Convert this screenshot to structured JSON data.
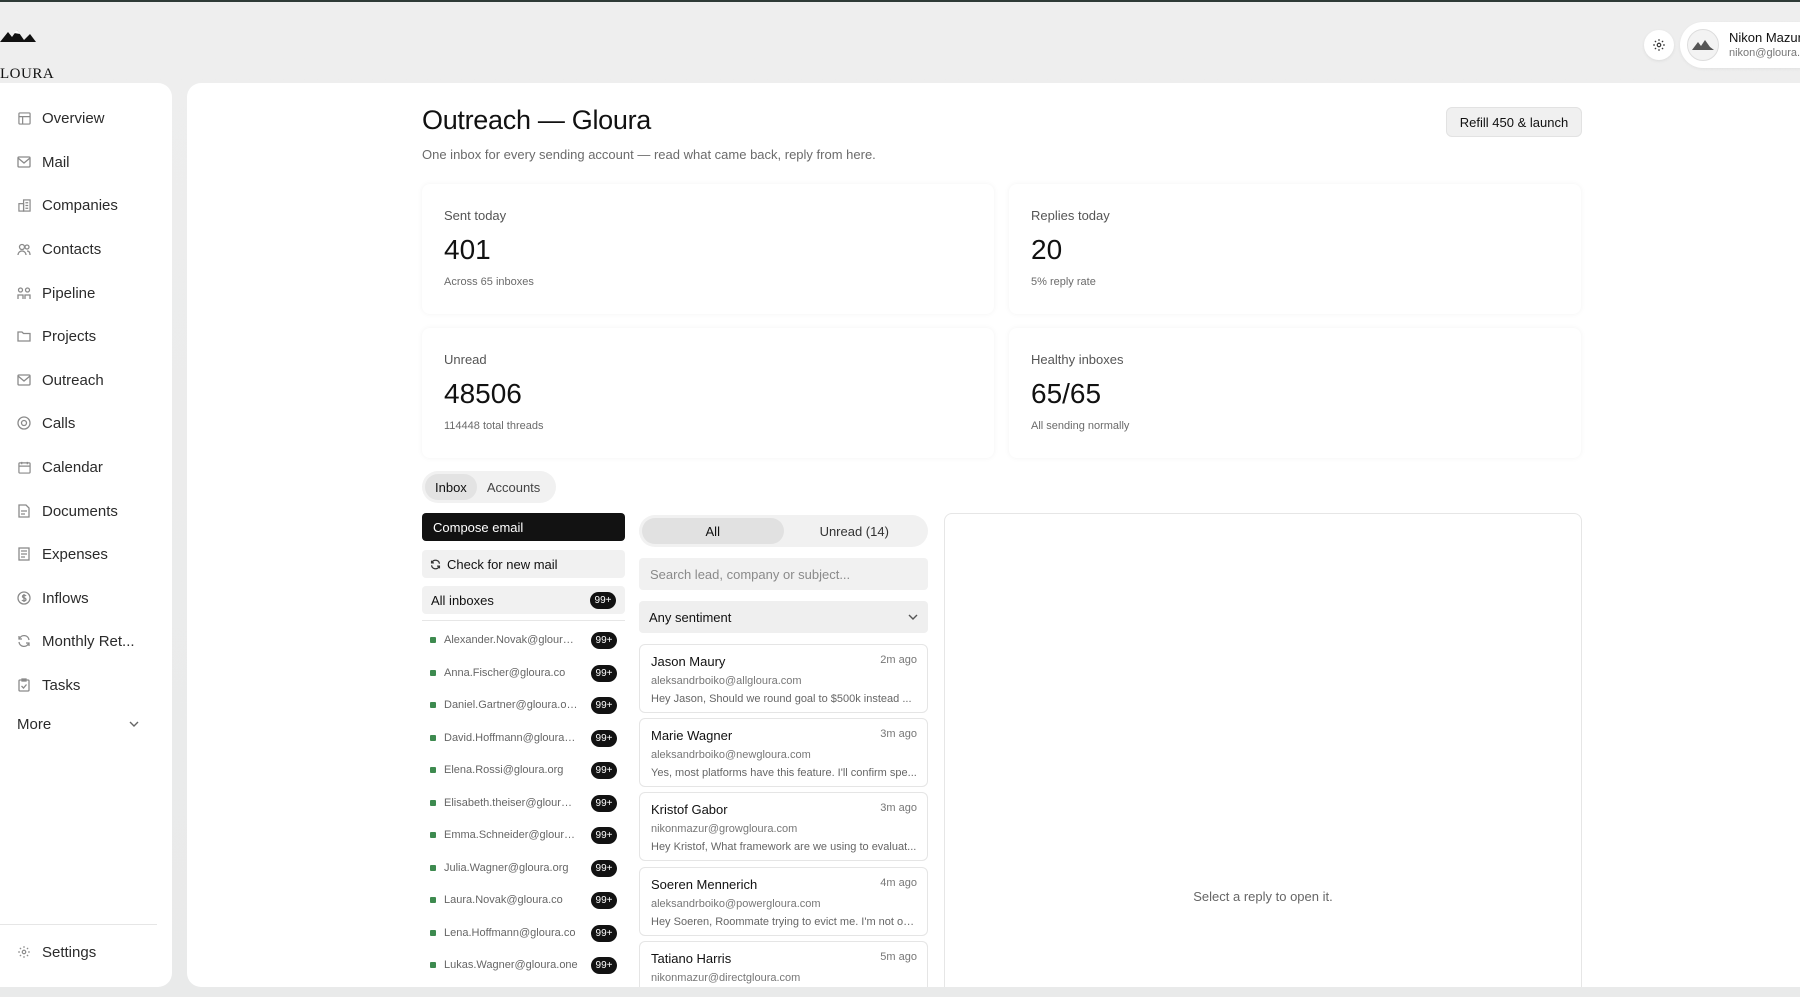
{
  "brand": {
    "logo_text": "LOURA"
  },
  "user": {
    "name": "Nikon Mazur",
    "email": "nikon@gloura.io"
  },
  "sidebar": {
    "items": [
      {
        "label": "Overview",
        "icon": "dashboard-icon"
      },
      {
        "label": "Mail",
        "icon": "mail-icon"
      },
      {
        "label": "Companies",
        "icon": "building-icon"
      },
      {
        "label": "Contacts",
        "icon": "users-icon"
      },
      {
        "label": "Pipeline",
        "icon": "pipeline-icon"
      },
      {
        "label": "Projects",
        "icon": "folder-icon"
      },
      {
        "label": "Outreach",
        "icon": "outreach-mail-icon"
      },
      {
        "label": "Calls",
        "icon": "calls-icon"
      },
      {
        "label": "Calendar",
        "icon": "calendar-icon"
      },
      {
        "label": "Documents",
        "icon": "document-icon"
      },
      {
        "label": "Expenses",
        "icon": "receipt-icon"
      },
      {
        "label": "Inflows",
        "icon": "dollar-circle-icon"
      },
      {
        "label": "Monthly Ret...",
        "icon": "refresh-icon"
      },
      {
        "label": "Tasks",
        "icon": "clipboard-icon"
      }
    ],
    "more_label": "More",
    "settings_label": "Settings"
  },
  "page": {
    "title": "Outreach — Gloura",
    "subtitle": "One inbox for every sending account — read what came back, reply from here.",
    "primary_button": "Refill 450 & launch"
  },
  "stats": [
    {
      "label": "Sent today",
      "value": "401",
      "sub": "Across 65 inboxes"
    },
    {
      "label": "Replies today",
      "value": "20",
      "sub": "5% reply rate"
    },
    {
      "label": "Unread",
      "value": "48506",
      "sub": "114448 total threads"
    },
    {
      "label": "Healthy inboxes",
      "value": "65/65",
      "sub": "All sending normally"
    }
  ],
  "tabs": [
    {
      "label": "Inbox",
      "active": true
    },
    {
      "label": "Accounts",
      "active": false
    }
  ],
  "inbox": {
    "compose_label": "Compose email",
    "check_label": "Check for new mail",
    "all_inboxes_label": "All inboxes",
    "all_inboxes_badge": "99+",
    "accounts": [
      {
        "address": "Alexander.Novak@gloura....",
        "badge": "99+"
      },
      {
        "address": "Anna.Fischer@gloura.co",
        "badge": "99+"
      },
      {
        "address": "Daniel.Gartner@gloura.one",
        "badge": "99+"
      },
      {
        "address": "David.Hoffmann@gloura.o...",
        "badge": "99+"
      },
      {
        "address": "Elena.Rossi@gloura.org",
        "badge": "99+"
      },
      {
        "address": "Elisabeth.theiser@gloura....",
        "badge": "99+"
      },
      {
        "address": "Emma.Schneider@gloura....",
        "badge": "99+"
      },
      {
        "address": "Julia.Wagner@gloura.org",
        "badge": "99+"
      },
      {
        "address": "Laura.Novak@gloura.co",
        "badge": "99+"
      },
      {
        "address": "Lena.Hoffmann@gloura.co",
        "badge": "99+"
      },
      {
        "address": "Lukas.Wagner@gloura.one",
        "badge": "99+"
      }
    ]
  },
  "threads": {
    "filter_all": "All",
    "filter_unread": "Unread (14)",
    "search_placeholder": "Search lead, company or subject...",
    "sentiment_label": "Any sentiment",
    "items": [
      {
        "name": "Jason Maury",
        "time": "2m ago",
        "email": "aleksandrboiko@allgloura.com",
        "preview": "Hey Jason, Should we round goal to $500k instead ..."
      },
      {
        "name": "Marie Wagner",
        "time": "3m ago",
        "email": "aleksandrboiko@newgloura.com",
        "preview": "Yes, most platforms have this feature. I'll confirm spe..."
      },
      {
        "name": "Kristof Gabor",
        "time": "3m ago",
        "email": "nikonmazur@growgloura.com",
        "preview": "Hey Kristof, What framework are we using to evaluat..."
      },
      {
        "name": "Soeren Mennerich",
        "time": "4m ago",
        "email": "aleksandrboiko@powergloura.com",
        "preview": "Hey Soeren, Roommate trying to evict me. I'm not on..."
      },
      {
        "name": "Tatiano Harris",
        "time": "5m ago",
        "email": "nikonmazur@directgloura.com",
        "preview": ""
      }
    ]
  },
  "reading_pane": {
    "empty_text": "Select a reply to open it."
  }
}
